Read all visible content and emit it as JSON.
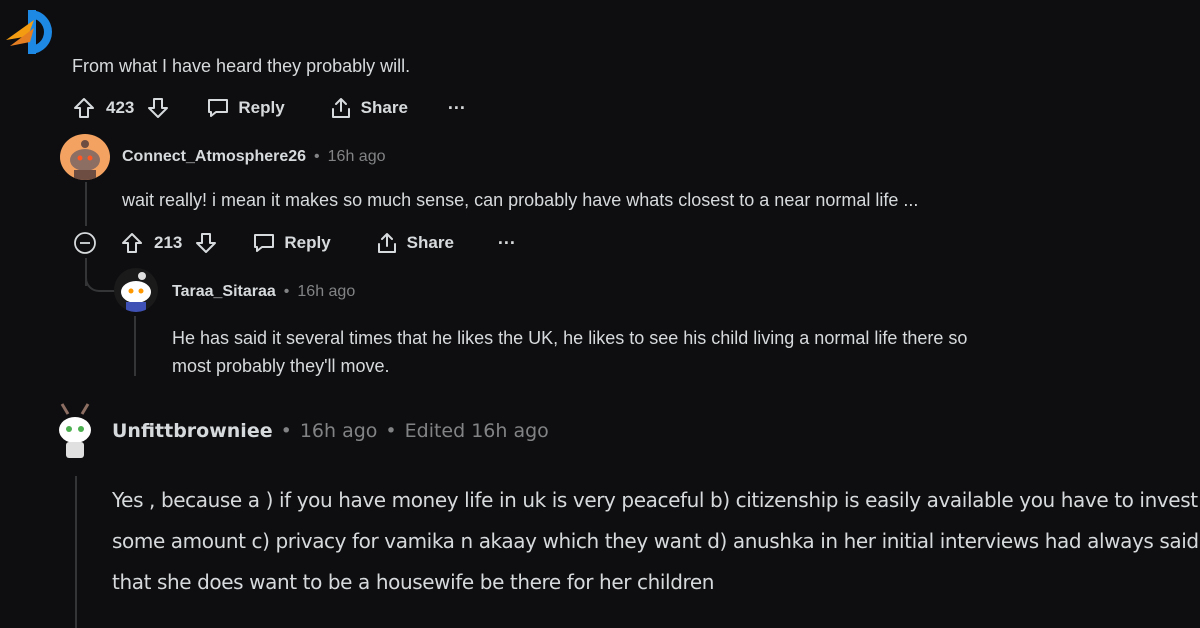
{
  "top_comment": {
    "text": "From what I have heard they probably will.",
    "votes": "423",
    "reply_label": "Reply",
    "share_label": "Share",
    "more_label": "···"
  },
  "reply1": {
    "username": "Connect_Atmosphere26",
    "sep": "•",
    "time": "16h ago",
    "text": "wait really! i mean it makes so much sense, can probably have whats closest to a near normal life ...",
    "votes": "213",
    "reply_label": "Reply",
    "share_label": "Share",
    "more_label": "···"
  },
  "reply2": {
    "username": "Taraa_Sitaraa",
    "sep": "•",
    "time": "16h ago",
    "text_line1": "He has said it several times that he likes the UK, he likes to see his child living a normal life there so",
    "text_line2": "most probably they'll move."
  },
  "comment3": {
    "username": "Unfittbrowniee",
    "sep1": "•",
    "time": "16h ago",
    "sep2": "•",
    "edited": "Edited 16h ago",
    "line1": "Yes , because a ) if you have money life in uk is very peaceful b) citizenship is easily available you have to invest",
    "line2": "some amount c) privacy for vamika n akaay which they want d) anushka in her initial interviews had always said",
    "line3": "that she does want to be a housewife be there for her children"
  },
  "colors": {
    "background": "#0e0e10",
    "text": "#d7dadc",
    "meta": "#818384",
    "logo_blue": "#1e88e5",
    "logo_orange": "#f39c12"
  }
}
